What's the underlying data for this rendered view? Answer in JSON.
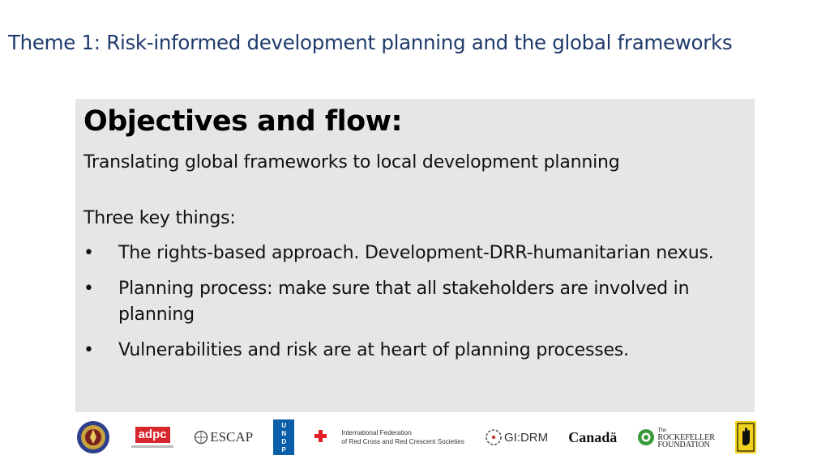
{
  "slide": {
    "title": "Theme 1: Risk-informed development planning and the global frameworks",
    "heading": "Objectives and flow:",
    "subtitle": "Translating global frameworks to local development planning",
    "lead": "Three key things:",
    "bullet_symbol": "•",
    "bullets": [
      "The rights-based approach. Development-DRR-humanitarian nexus.",
      "Planning process: make sure that all stakeholders are involved in planning",
      "Vulnerabilities and risk are at heart of planning processes."
    ]
  },
  "logos": {
    "adpc": "adpc",
    "escap": "ESCAP",
    "undp": "U N D P",
    "ifrc_line1": "International Federation",
    "ifrc_line2": "of Red Cross and Red Crescent Societies",
    "gidrm": "GI:DRM",
    "canada": "Canadä",
    "rockefeller_line1": "The",
    "rockefeller_line2": "ROCKEFELLER",
    "rockefeller_line3": "FOUNDATION"
  },
  "colors": {
    "title": "#1f3a6b",
    "panel": "#e6e6e6",
    "adpc_red": "#d7262c",
    "ifrc_red": "#e21f26",
    "undp_blue": "#0a5ea8",
    "rockefeller_green": "#3a9a3a"
  }
}
